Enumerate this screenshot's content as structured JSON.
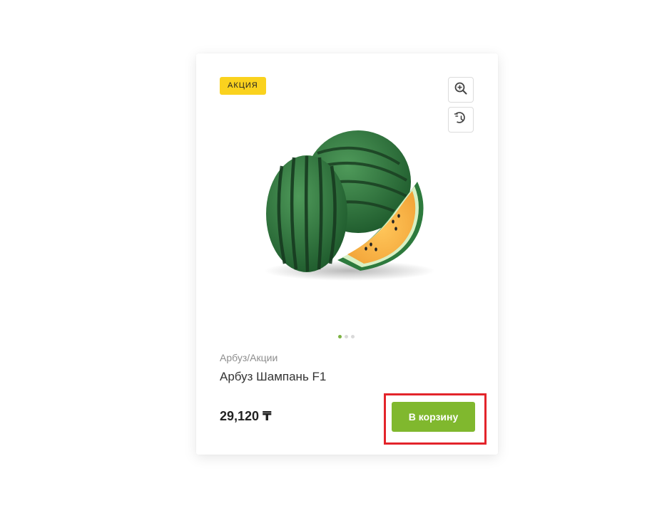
{
  "colors": {
    "badge_bg": "#fad21e",
    "accent_green": "#80b82e",
    "highlight_red": "#e3242b",
    "dot_active": "#7cb342"
  },
  "product": {
    "badge": "АКЦИЯ",
    "breadcrumb": "Арбуз/Акции",
    "name": "Арбуз Шампань F1",
    "price": "29,120 ₸",
    "add_to_cart": "В корзину",
    "image_alt": "watermelon-product-image",
    "icons": [
      "zoom-in-icon",
      "history-icon"
    ],
    "gallery_active_index": 0,
    "gallery_count": 3
  }
}
